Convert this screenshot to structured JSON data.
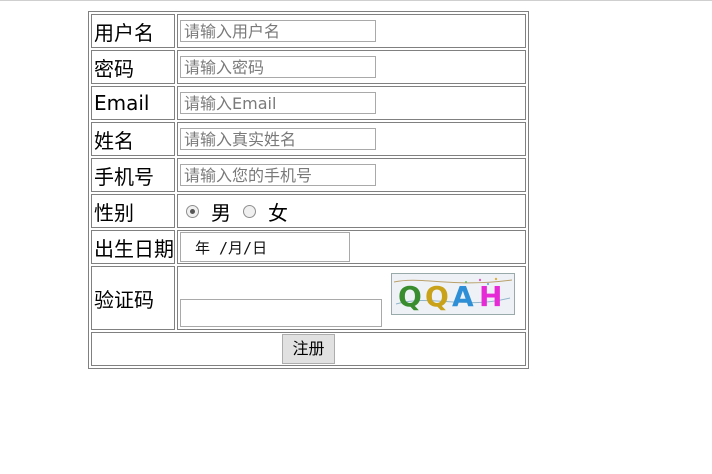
{
  "form": {
    "fields": {
      "username": {
        "label": "用户名",
        "placeholder": "请输入用户名",
        "value": ""
      },
      "password": {
        "label": "密码",
        "placeholder": "请输入密码",
        "value": ""
      },
      "email": {
        "label": "Email",
        "placeholder": "请输入Email",
        "value": ""
      },
      "name": {
        "label": "姓名",
        "placeholder": "请输入真实姓名",
        "value": ""
      },
      "phone": {
        "label": "手机号",
        "placeholder": "请输入您的手机号",
        "value": ""
      }
    },
    "gender": {
      "label": "性别",
      "options": [
        {
          "label": "男",
          "checked": true
        },
        {
          "label": "女",
          "checked": false
        }
      ]
    },
    "birthday": {
      "label": "出生日期",
      "display": "年 /月/日"
    },
    "captcha": {
      "label": "验证码",
      "code": "QQAH",
      "value": ""
    },
    "submit_label": "注册"
  },
  "colors": {
    "border": "#808080",
    "button_bg": "#e1e1e1",
    "captcha_letters": [
      "#3a8d2f",
      "#c9a21a",
      "#2e8fd6",
      "#e62ad6"
    ]
  }
}
